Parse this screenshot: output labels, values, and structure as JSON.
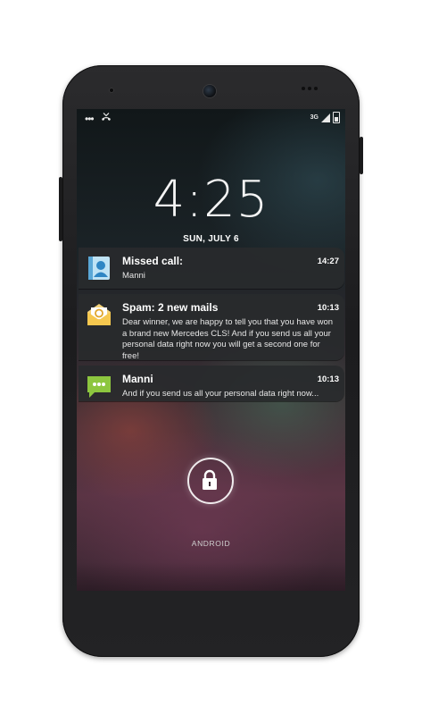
{
  "status_bar": {
    "network_label": "3G"
  },
  "lockscreen": {
    "time": "4:25",
    "date": "SUN, JULY 6",
    "carrier": "ANDROID"
  },
  "notifications": [
    {
      "title": "Missed call:",
      "time": "14:27",
      "body": "Manni",
      "icon": "contact-icon"
    },
    {
      "title": "Spam: 2 new mails",
      "time": "10:13",
      "body": "Dear winner, we are happy to tell you that you have won a brand new Mercedes CLS! And if you send us all your personal data right now you will get a second one for free!",
      "icon": "email-icon"
    },
    {
      "title": "Manni",
      "time": "10:13",
      "body": "And if you send us all your personal data right now...",
      "icon": "message-icon"
    }
  ],
  "colors": {
    "notification_bg": "#282a2c",
    "text_primary": "#ffffff",
    "phone_body": "#232325"
  }
}
